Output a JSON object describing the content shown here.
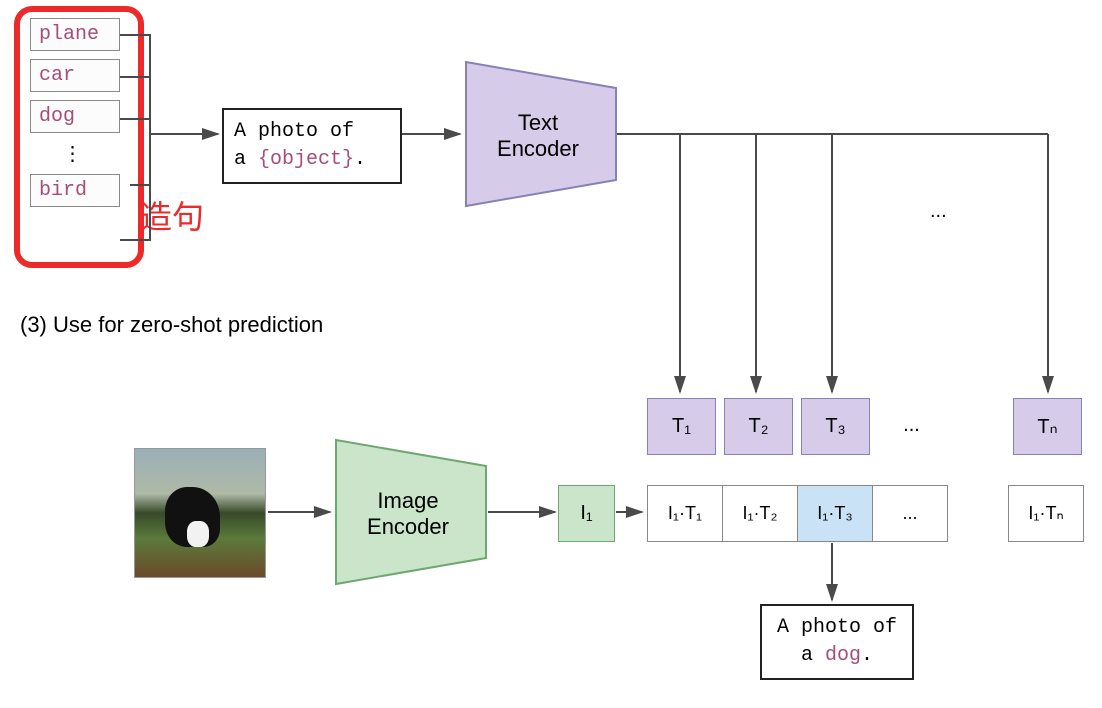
{
  "classes": {
    "items": [
      "plane",
      "car",
      "dog",
      "bird"
    ],
    "highlight_label": "造句"
  },
  "prompt_template": {
    "line1": "A photo of",
    "line2_prefix": "a ",
    "line2_obj": "{object}",
    "line2_suffix": "."
  },
  "encoders": {
    "text": "Text\nEncoder",
    "image": "Image\nEncoder"
  },
  "caption": "(3) Use for zero-shot prediction",
  "tokens": {
    "t": [
      "T₁",
      "T₂",
      "T₃",
      "...",
      "Tₙ"
    ],
    "i1": "I₁"
  },
  "scores": {
    "items": [
      "I₁·T₁",
      "I₁·T₂",
      "I₁·T₃",
      "...",
      "I₁·Tₙ"
    ],
    "highlight_index": 2
  },
  "result": {
    "line1": "A photo of",
    "line2_prefix": "a ",
    "line2_obj": "dog",
    "line2_suffix": "."
  },
  "ellipsis_top": "...",
  "vellipsis": "⋮"
}
